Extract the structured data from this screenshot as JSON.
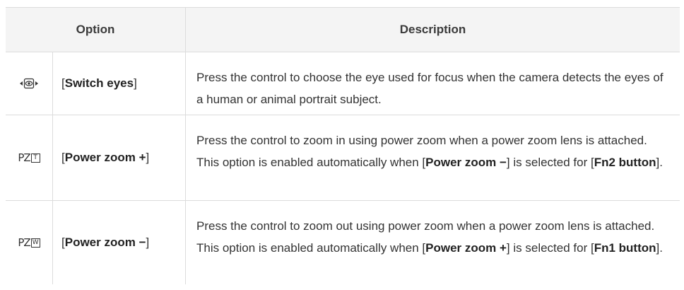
{
  "table": {
    "headers": {
      "option": "Option",
      "description": "Description"
    },
    "rows": [
      {
        "icon": "switch-eyes-icon",
        "name_open": "[",
        "name_bold": "Switch eyes",
        "name_close": "]",
        "desc": [
          {
            "t": "Press the control to choose the eye used for focus when the camera detects the eyes of a human or animal portrait subject.",
            "b": false
          }
        ]
      },
      {
        "icon": "power-zoom-tele-icon",
        "name_open": "[",
        "name_bold": "Power zoom +",
        "name_close": "]",
        "desc": [
          {
            "t": "Press the control to zoom in using power zoom when a power zoom lens is attached. This option is enabled automatically when [",
            "b": false
          },
          {
            "t": "Power zoom −",
            "b": true
          },
          {
            "t": "] is selected for [",
            "b": false
          },
          {
            "t": "Fn2 button",
            "b": true
          },
          {
            "t": "].",
            "b": false
          }
        ]
      },
      {
        "icon": "power-zoom-wide-icon",
        "name_open": "[",
        "name_bold": "Power zoom −",
        "name_close": "]",
        "desc": [
          {
            "t": "Press the control to zoom out using power zoom when a power zoom lens is attached. This option is enabled automatically when [",
            "b": false
          },
          {
            "t": "Power zoom +",
            "b": true
          },
          {
            "t": "] is selected for [",
            "b": false
          },
          {
            "t": "Fn1 button",
            "b": true
          },
          {
            "t": "].",
            "b": false
          }
        ]
      }
    ]
  },
  "icon_glyphs": {
    "pz_prefix": "PZ",
    "tele_letter": "T",
    "wide_letter": "W"
  }
}
